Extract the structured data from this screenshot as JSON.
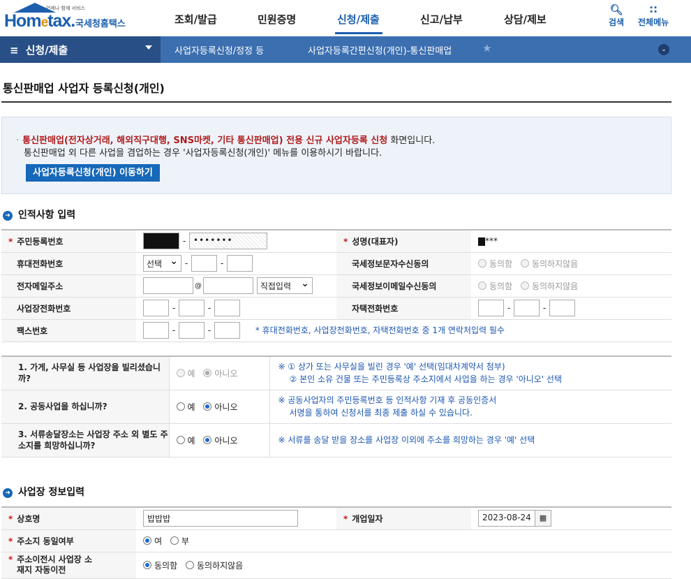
{
  "header": {
    "logo": {
      "tagline": "언제나 함께 서비스",
      "word_a": "Hom",
      "word_e": "e",
      "word_b": "tax.",
      "korean": "국세청홈택스"
    },
    "nav": [
      "조회/발급",
      "민원증명",
      "신청/제출",
      "신고/납부",
      "상담/제보"
    ],
    "active_nav": "신청/제출",
    "search_label": "검색",
    "allmenu_label": "전체메뉴"
  },
  "menubar": {
    "menu_label": "신청/제출",
    "crumb1": "사업자등록신청/정정 등",
    "crumb2": "사업자등록간편신청(개인)-통신판매업"
  },
  "page": {
    "title": "통신판매업 사업자 등록신청(개인)"
  },
  "notice": {
    "bullet": "·",
    "highlight": "통신판매업(전자상거래, 해외직구대행, SNS마켓, 기타 통신판매업) 전용 신규 사업자등록 신청",
    "line1_tail": " 화면입니다.",
    "line2": "통신판매업 외 다른 사업을 겸업하는 경우 '사업자등록신청(개인)' 메뉴를 이용하시기 바랍니다.",
    "button": "사업자등록신청(개인) 이동하기"
  },
  "section1": {
    "title": "인적사항 입력",
    "rrn_label": "주민등록번호",
    "rrn_back": "•••••••",
    "name_label": "성명(대표자)",
    "name_value": "***",
    "mobile_label": "휴대전화번호",
    "mobile_select": "선택",
    "sms_label": "국세정보문자수신동의",
    "agree": "동의함",
    "disagree": "동의하지않음",
    "email_label": "전자메일주소",
    "at": "@",
    "email_select": "직접입력",
    "email_consent_label": "국세정보이메일수신동의",
    "bizphone_label": "사업장전화번호",
    "homephone_label": "자택전화번호",
    "fax_label": "팩스번호",
    "contact_note": "* 휴대전화번호, 사업장전화번호, 자택전화번호 중 1개 연락처입력 필수"
  },
  "questions": [
    {
      "q": "1. 가게, 사무실 등 사업장을 빌리셨습니까?",
      "yes": "예",
      "no": "아니오",
      "selected": "no",
      "disabled": true,
      "note1": "※ ① 상가 또는 사무실을 빌린 경우 '예' 선택(임대차계약서 첨부)",
      "note2": "② 본인 소유 건물 또는 주민등록상 주소지에서 사업을 하는 경우 '아니오' 선택"
    },
    {
      "q": "2. 공동사업을 하십니까?",
      "yes": "예",
      "no": "아니오",
      "selected": "no",
      "disabled": false,
      "note1": "※ 공동사업자의 주민등록번호 등 인적사항 기재 후 공동인증서",
      "note2": "서명을 통하여 신청서를 최종 제출 하실 수 있습니다."
    },
    {
      "q": "3. 서류송달장소는 사업장 주소 외 별도 주소지를 희망하십니까?",
      "yes": "예",
      "no": "아니오",
      "selected": "no",
      "disabled": false,
      "note1": "※ 서류를 송달 받을 장소를 사업장 이외에 주소를 희망하는 경우 '예' 선택",
      "note2": ""
    }
  ],
  "section2": {
    "title": "사업장 정보입력",
    "trade_label": "상호명",
    "trade_value": "밥밥밥",
    "open_label": "개업일자",
    "open_value": "2023-08-24",
    "same_addr_label": "주소지 동일여부",
    "yes": "여",
    "no": "부",
    "move_label": "주소이전시 사업장 소재지 자동이전",
    "agree": "동의함",
    "disagree": "동의하지않음"
  },
  "colors": {
    "brand": "#1b5fae",
    "accent_orange": "#e88a00",
    "bar": "#3b6fb0",
    "bar_dark": "#284f86",
    "button": "#1668b8",
    "required": "#c21b1b",
    "note": "#1a56b0"
  },
  "icons": {
    "search": "magnifier-icon",
    "allmenu": "grid-icon",
    "menu": "hamburger-icon",
    "favorite": "star-icon",
    "expand": "chevron-down-icon",
    "calendar": "calendar-icon"
  }
}
